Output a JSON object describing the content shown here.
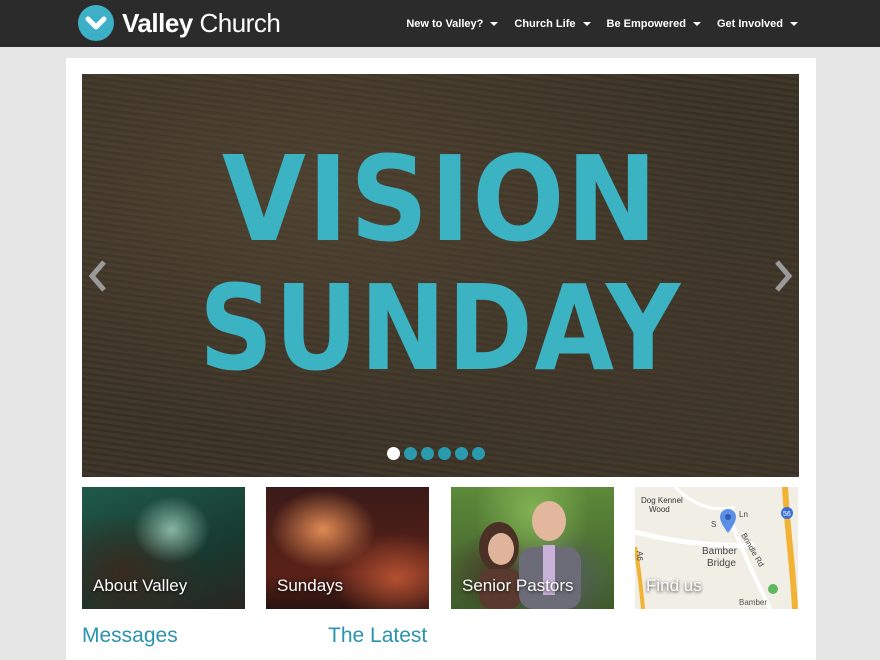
{
  "header": {
    "logo_bold": "Valley",
    "logo_light": "Church",
    "nav": [
      {
        "label": "New to Valley?"
      },
      {
        "label": "Church Life"
      },
      {
        "label": "Be Empowered"
      },
      {
        "label": "Get Involved"
      }
    ]
  },
  "slider": {
    "line1": "VISION",
    "line2": "SUNDAY",
    "slide_count": 6,
    "active_slide": 1
  },
  "tiles": [
    {
      "label": "About Valley"
    },
    {
      "label": "Sundays"
    },
    {
      "label": "Senior Pastors"
    },
    {
      "label": "Find us"
    }
  ],
  "map": {
    "labels": [
      "Dog Kennel",
      "Wood",
      "Bamber",
      "Bridge",
      "Brindle Rd",
      "S",
      "Ln",
      "A6",
      "56",
      "Bamber"
    ]
  },
  "sections": {
    "messages": "Messages",
    "latest": "The Latest"
  },
  "colors": {
    "accent": "#3bb3c3",
    "heading": "#2a94ad",
    "navbar": "#2b2b2b"
  }
}
